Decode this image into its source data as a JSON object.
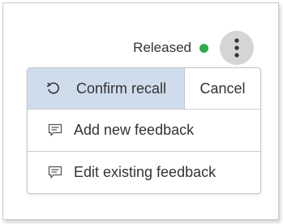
{
  "status": {
    "label": "Released",
    "dot_color": "#2eaa4a"
  },
  "more_button": {
    "icon": "more-vertical-icon"
  },
  "menu": {
    "confirm_recall": {
      "label": "Confirm recall",
      "icon": "undo-icon"
    },
    "cancel": {
      "label": "Cancel"
    },
    "items": [
      {
        "label": "Add new feedback",
        "icon": "feedback-icon"
      },
      {
        "label": "Edit existing feedback",
        "icon": "feedback-icon"
      }
    ]
  },
  "colors": {
    "highlight": "#cfdcec",
    "status_green": "#2eaa4a",
    "kebab_bg": "#d5d5d5"
  }
}
